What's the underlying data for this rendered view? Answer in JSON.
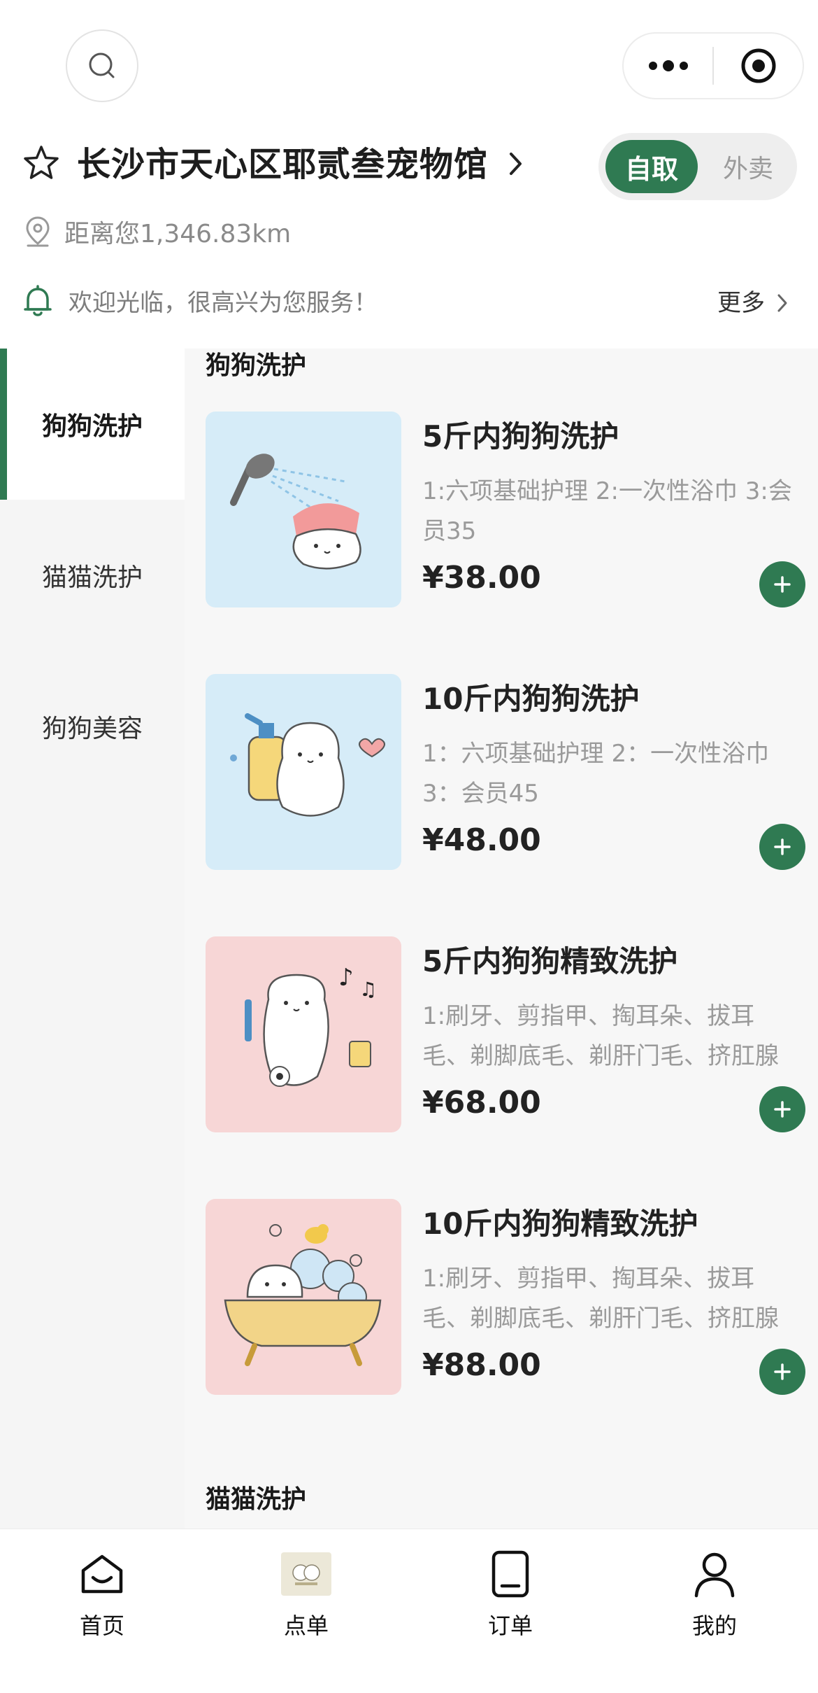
{
  "header": {
    "store_name": "长沙市天心区耶贰叁宠物馆",
    "mode_pickup": "自取",
    "mode_delivery": "外卖",
    "distance": "距离您1,346.83km",
    "welcome": "欢迎光临，很高兴为您服务！",
    "more": "更多"
  },
  "sidebar": {
    "items": [
      {
        "label": "狗狗洗护",
        "active": true
      },
      {
        "label": "猫猫洗护",
        "active": false
      },
      {
        "label": "狗狗美容",
        "active": false
      }
    ]
  },
  "sections": [
    {
      "title": "狗狗洗护",
      "products": [
        {
          "name": "5斤内狗狗洗护",
          "desc": "1:六项基础护理 2:一次性浴巾 3:会员35",
          "price": "¥38.00",
          "image": "dog-shower"
        },
        {
          "name": "10斤内狗狗洗护",
          "desc": "1：六项基础护理 2：一次性浴巾 3：会员45",
          "price": "¥48.00",
          "image": "dog-shampoo"
        },
        {
          "name": "5斤内狗狗精致洗护",
          "desc": "1:刷牙、剪指甲、掏耳朵、拔耳毛、剃脚底毛、剃肝门毛、挤肛腺",
          "price": "¥68.00",
          "image": "dog-toothbrush"
        },
        {
          "name": "10斤内狗狗精致洗护",
          "desc": "1:刷牙、剪指甲、掏耳朵、拔耳毛、剃脚底毛、剃肝门毛、挤肛腺",
          "price": "¥88.00",
          "image": "dog-bathtub"
        }
      ]
    },
    {
      "title": "猫猫洗护"
    }
  ],
  "tabbar": {
    "items": [
      {
        "label": "首页",
        "icon": "home-icon"
      },
      {
        "label": "点单",
        "icon": "store-logo"
      },
      {
        "label": "订单",
        "icon": "order-icon"
      },
      {
        "label": "我的",
        "icon": "profile-icon"
      }
    ]
  },
  "colors": {
    "accent": "#2f7a52",
    "thumb_blue": "#d6ecf8",
    "thumb_pink": "#f7d6d6"
  }
}
